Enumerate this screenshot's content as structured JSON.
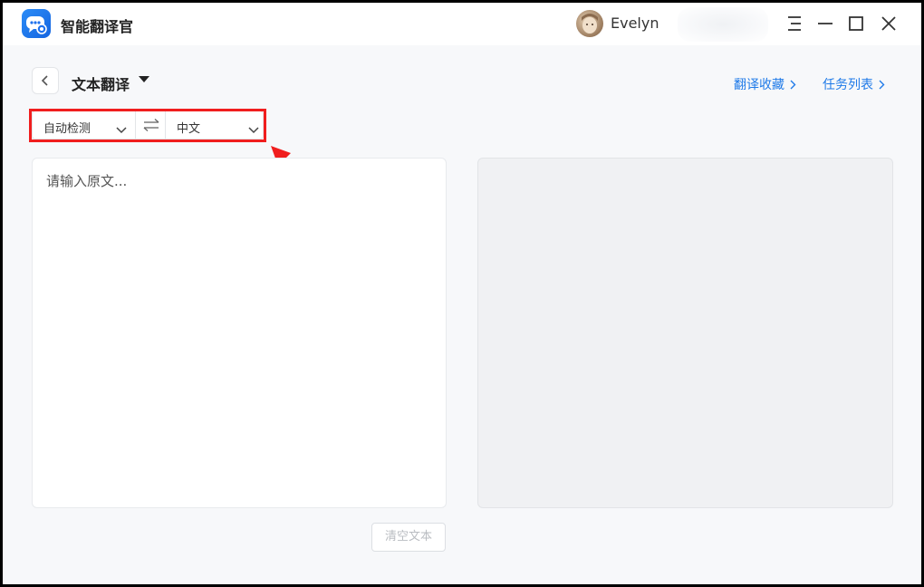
{
  "app": {
    "name": "智能翻译官"
  },
  "user": {
    "name": "Evelyn"
  },
  "window_controls": [
    "menu-icon",
    "minimize-icon",
    "maximize-icon",
    "close-icon"
  ],
  "header": {
    "title": "文本翻译",
    "links": {
      "favorites": "翻译收藏",
      "tasks": "任务列表"
    }
  },
  "language": {
    "source": "自动检测",
    "target": "中文"
  },
  "editor": {
    "placeholder": "请输入原文..."
  },
  "actions": {
    "clear": "清空文本"
  },
  "colors": {
    "accent": "#1f7ae8",
    "annotation": "#f01e1e",
    "logo": "#1f72ee"
  }
}
